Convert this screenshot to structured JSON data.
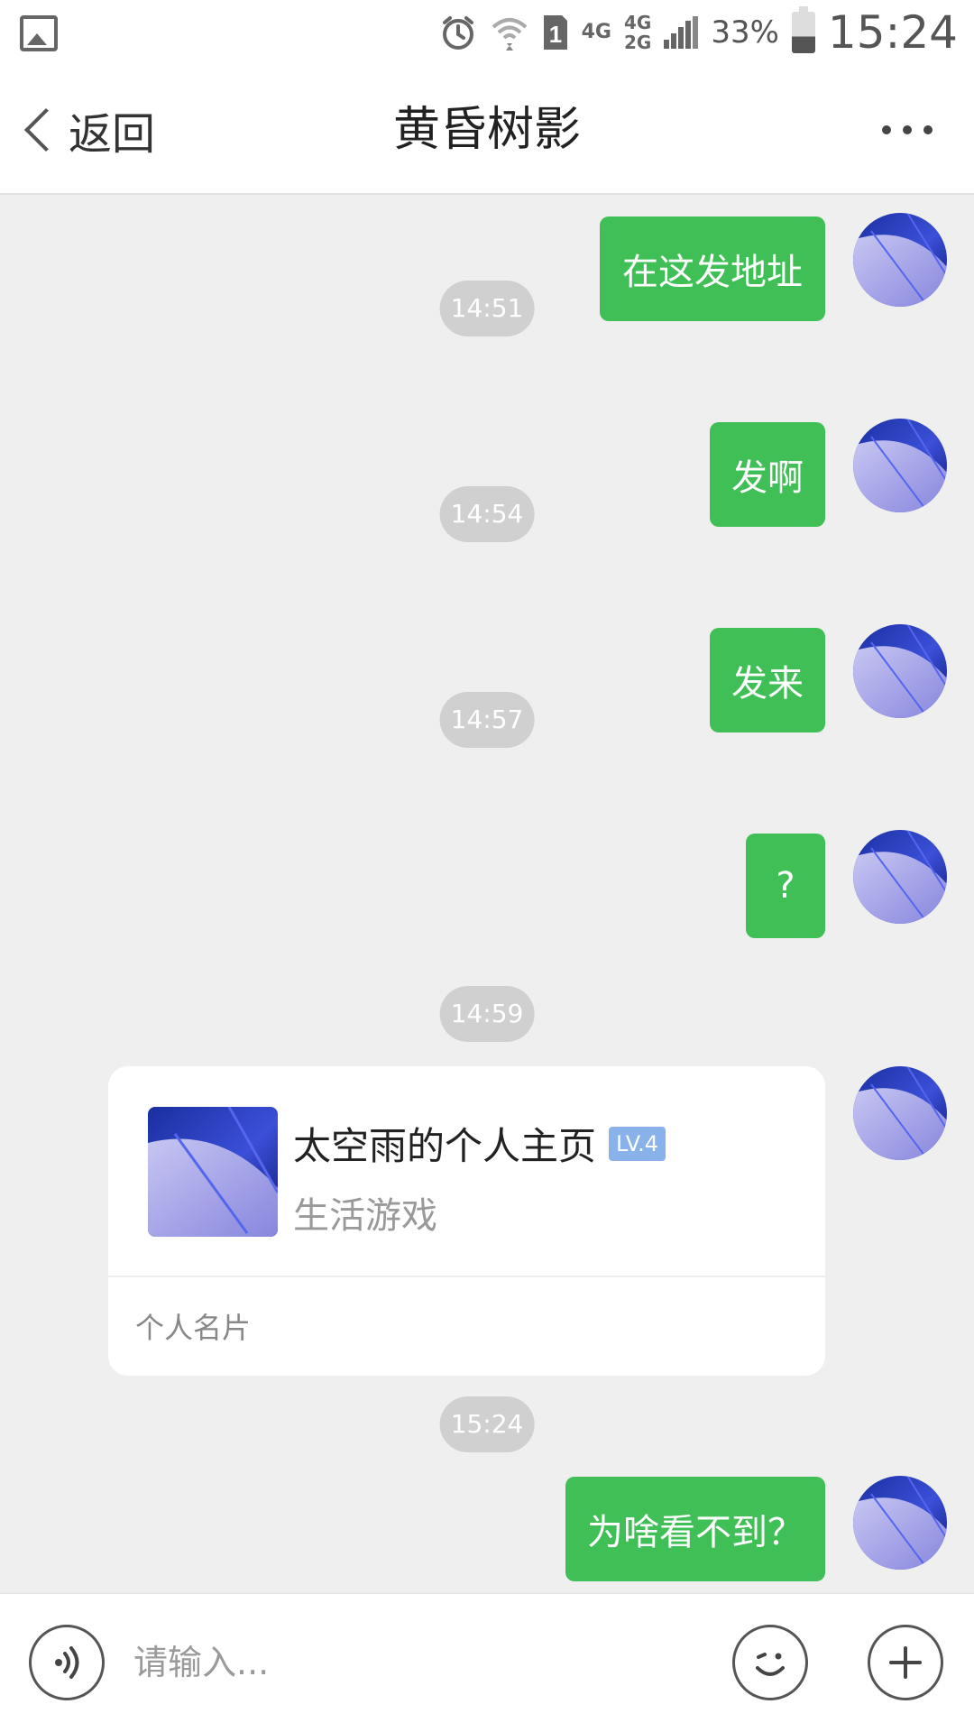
{
  "status_bar": {
    "network_primary": "4G",
    "network_secondary_top": "4G",
    "network_secondary_bottom": "2G",
    "sim_label": "1",
    "battery_percent": "33%",
    "time": "15:24",
    "icons": [
      "gallery-icon",
      "alarm-icon",
      "wifi-icon",
      "sim-icon",
      "signal-icon",
      "battery-icon"
    ]
  },
  "header": {
    "back_label": "返回",
    "title": "黄昏树影",
    "more_icon": "more-icon"
  },
  "messages": [
    {
      "type": "outgoing",
      "text": "在这发地址"
    },
    {
      "type": "timestamp",
      "text": "14:51"
    },
    {
      "type": "outgoing",
      "text": "发啊"
    },
    {
      "type": "timestamp",
      "text": "14:54"
    },
    {
      "type": "outgoing",
      "text": "发来"
    },
    {
      "type": "timestamp",
      "text": "14:57"
    },
    {
      "type": "outgoing",
      "text": "?"
    },
    {
      "type": "timestamp",
      "text": "14:59"
    },
    {
      "type": "card",
      "title": "太空雨的个人主页",
      "badge": "LV.4",
      "subtitle": "生活游戏",
      "footer": "个人名片"
    },
    {
      "type": "timestamp",
      "text": "15:24"
    },
    {
      "type": "outgoing",
      "text": "为啥看不到？"
    }
  ],
  "input_bar": {
    "placeholder": "请输入...",
    "value": "",
    "left_icon": "voice-icon",
    "right_icons": [
      "emoji-icon",
      "plus-icon"
    ]
  },
  "colors": {
    "bubble": "#3fbf55",
    "timestamp_pill": "#d0d0d0",
    "badge": "#8ab2ea",
    "background": "#efefef"
  }
}
